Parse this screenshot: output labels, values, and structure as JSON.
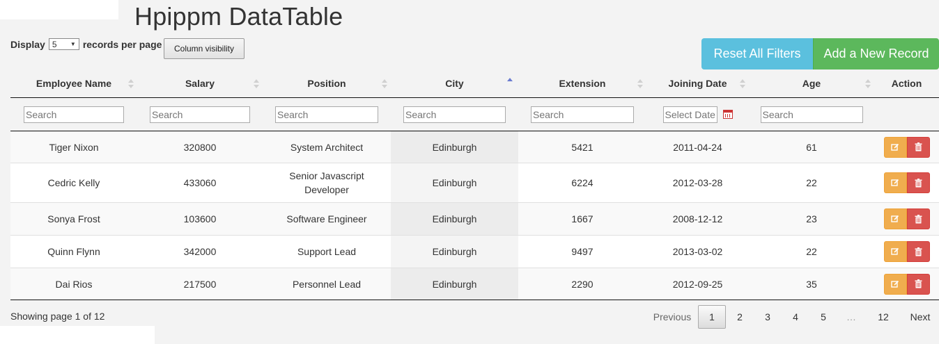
{
  "title": "Hpippm DataTable",
  "display": {
    "prefix": "Display",
    "value": "5",
    "suffix": "records per page"
  },
  "column_visibility_label": "Column visibility",
  "reset_label": "Reset All Filters",
  "add_label": "Add a New Record",
  "columns": [
    "Employee Name",
    "Salary",
    "Position",
    "City",
    "Extension",
    "Joining Date",
    "Age",
    "Action"
  ],
  "sorted_column": "City",
  "sort_direction": "ascending",
  "filters": {
    "search_placeholder": "Search",
    "date_placeholder": "Select Date"
  },
  "rows": [
    [
      "Tiger Nixon",
      "320800",
      "System Architect",
      "Edinburgh",
      "5421",
      "2011-04-24",
      "61"
    ],
    [
      "Cedric Kelly",
      "433060",
      "Senior Javascript Developer",
      "Edinburgh",
      "6224",
      "2012-03-28",
      "22"
    ],
    [
      "Sonya Frost",
      "103600",
      "Software Engineer",
      "Edinburgh",
      "1667",
      "2008-12-12",
      "23"
    ],
    [
      "Quinn Flynn",
      "342000",
      "Support Lead",
      "Edinburgh",
      "9497",
      "2013-03-02",
      "22"
    ],
    [
      "Dai Rios",
      "217500",
      "Personnel Lead",
      "Edinburgh",
      "2290",
      "2012-09-25",
      "35"
    ]
  ],
  "actions": {
    "edit_icon": "edit-icon",
    "delete_icon": "trash-icon"
  },
  "info": "Showing page 1 of 12",
  "pagination": {
    "previous": "Previous",
    "pages": [
      "1",
      "2",
      "3",
      "4",
      "5",
      "…",
      "12"
    ],
    "current": "1",
    "next": "Next"
  },
  "colors": {
    "info_button": "#5bc0de",
    "success_button": "#5cb85c",
    "edit_button": "#f0ad4e",
    "delete_button": "#d9534f"
  }
}
